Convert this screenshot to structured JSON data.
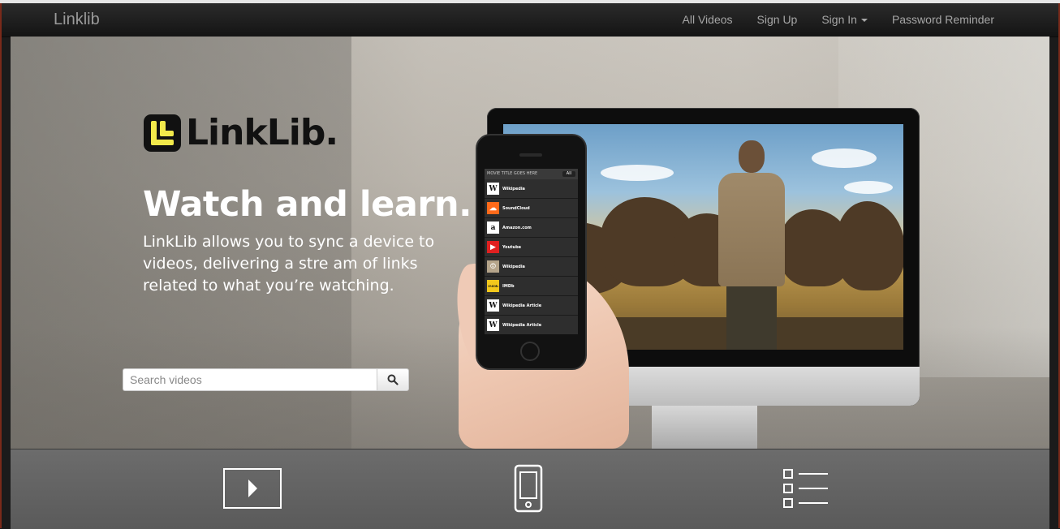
{
  "navbar": {
    "brand": "Linklib",
    "items": [
      {
        "label": "All Videos"
      },
      {
        "label": "Sign Up"
      },
      {
        "label": "Sign In"
      },
      {
        "label": "Password Reminder"
      }
    ]
  },
  "hero": {
    "logo_text": "LinkLib.",
    "headline": "Watch and learn.",
    "lede": "LinkLib allows you to sync a device to videos, delivering a stre am of links related to what you’re watching.",
    "search": {
      "placeholder": "Search videos"
    }
  },
  "phone_app": {
    "header_title": "MOVIE TITLE GOES HERE",
    "header_button": "All",
    "rows": [
      {
        "title": "Wikipedia",
        "icon": "W",
        "color": "#ffffff"
      },
      {
        "title": "SoundCloud",
        "icon": "☁",
        "color": "#ff6a1a"
      },
      {
        "title": "Amazon.com",
        "icon": "a",
        "color": "#ffffff"
      },
      {
        "title": "Youtube",
        "icon": "▶",
        "color": "#e02020"
      },
      {
        "title": "Wikipedia",
        "icon": "☺",
        "color": "#b5a48a"
      },
      {
        "title": "IMDb",
        "icon": "IMDb",
        "color": "#f3c81c"
      },
      {
        "title": "Wikipedia Article",
        "icon": "W",
        "color": "#ffffff"
      },
      {
        "title": "Wikipedia Article",
        "icon": "W",
        "color": "#ffffff"
      }
    ]
  },
  "features": [
    {
      "icon": "play-video-icon"
    },
    {
      "icon": "smartphone-icon"
    },
    {
      "icon": "checklist-icon"
    }
  ]
}
